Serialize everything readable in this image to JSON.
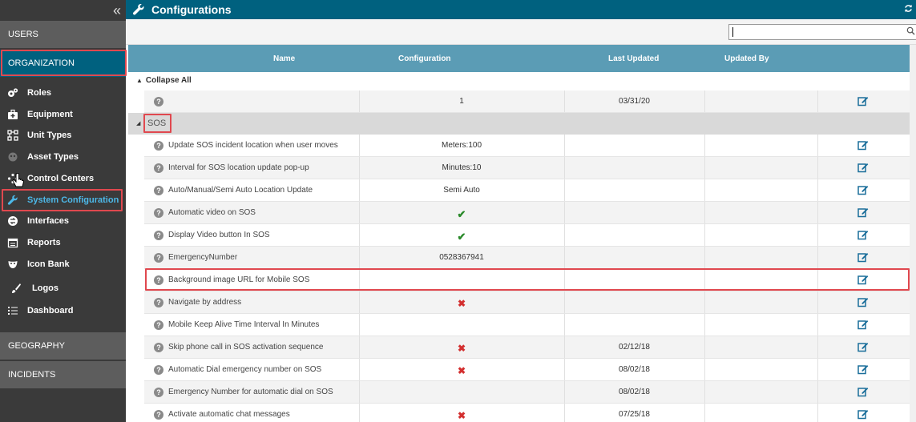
{
  "sidebar": {
    "collapse_glyph": "«",
    "sections": {
      "users": "USERS",
      "organization": "ORGANIZATION",
      "geography": "GEOGRAPHY",
      "incidents": "INCIDENTS"
    },
    "items": [
      {
        "label": "Roles",
        "icon": "gears-icon"
      },
      {
        "label": "Equipment",
        "icon": "medkit-icon"
      },
      {
        "label": "Unit Types",
        "icon": "sitemap-icon"
      },
      {
        "label": "Asset Types",
        "icon": "asset-icon"
      },
      {
        "label": "Control Centers",
        "icon": "control-center-icon"
      },
      {
        "label": "System Configuration",
        "icon": "wrench-icon"
      },
      {
        "label": "Interfaces",
        "icon": "interfaces-icon"
      },
      {
        "label": "Reports",
        "icon": "calendar-icon"
      },
      {
        "label": "Icon Bank",
        "icon": "mask-icon"
      },
      {
        "label": "Logos",
        "icon": "brush-icon"
      },
      {
        "label": "Dashboard",
        "icon": "list-icon"
      }
    ]
  },
  "header": {
    "title": "Configurations"
  },
  "search": {
    "value": "",
    "placeholder": ""
  },
  "table": {
    "columns": {
      "name": "Name",
      "configuration": "Configuration",
      "last_updated": "Last Updated",
      "updated_by": "Updated By"
    },
    "collapse_all": "Collapse All",
    "first_row": {
      "name": "",
      "configuration": "1",
      "last_updated": "03/31/20"
    },
    "group_label": "SOS",
    "rows": [
      {
        "name": "Update SOS incident location when user moves",
        "configuration": "Meters:100",
        "type": "text",
        "last_updated": ""
      },
      {
        "name": "Interval for SOS location update pop-up",
        "configuration": "Minutes:10",
        "type": "text",
        "last_updated": ""
      },
      {
        "name": "Auto/Manual/Semi Auto Location Update",
        "configuration": "Semi Auto",
        "type": "text",
        "last_updated": ""
      },
      {
        "name": "Automatic video on SOS",
        "configuration": "",
        "type": "check",
        "last_updated": ""
      },
      {
        "name": "Display Video button In SOS",
        "configuration": "",
        "type": "check",
        "last_updated": ""
      },
      {
        "name": "EmergencyNumber",
        "configuration": "0528367941",
        "type": "text",
        "last_updated": ""
      },
      {
        "name": "Background image URL for Mobile SOS",
        "configuration": "",
        "type": "text",
        "last_updated": ""
      },
      {
        "name": "Navigate by address",
        "configuration": "",
        "type": "cross",
        "last_updated": ""
      },
      {
        "name": "Mobile Keep Alive Time Interval In Minutes",
        "configuration": "",
        "type": "text",
        "last_updated": ""
      },
      {
        "name": "Skip phone call in SOS activation sequence",
        "configuration": "",
        "type": "cross",
        "last_updated": "02/12/18"
      },
      {
        "name": "Automatic Dial emergency number on SOS",
        "configuration": "",
        "type": "cross",
        "last_updated": "08/02/18"
      },
      {
        "name": "Emergency Number for automatic dial on SOS",
        "configuration": "",
        "type": "text",
        "last_updated": "08/02/18"
      },
      {
        "name": "Activate automatic chat messages",
        "configuration": "",
        "type": "cross",
        "last_updated": "07/25/18"
      }
    ]
  },
  "colors": {
    "header_bar": "#00617f",
    "table_header": "#5b9cb5",
    "highlight": "#e0484f",
    "edit_icon": "#1a6e9a"
  }
}
